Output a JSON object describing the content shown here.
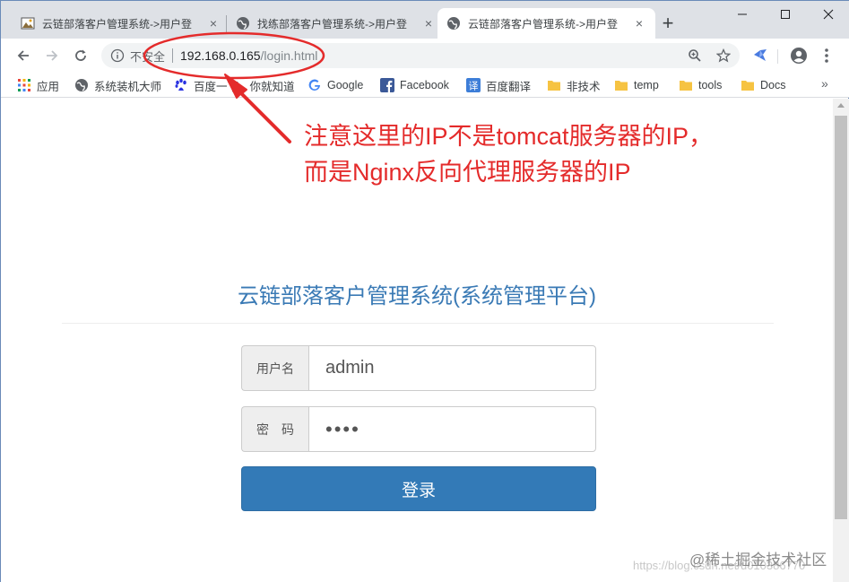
{
  "tabs": [
    {
      "title": "云链部落客户管理系统->用户登",
      "close": "×"
    },
    {
      "title": "找练部落客户管理系统->用户登",
      "close": "×"
    },
    {
      "title": "云链部落客户管理系统->用户登",
      "close": "×"
    }
  ],
  "new_tab": "+",
  "address": {
    "security_label": "不安全",
    "host": "192.168.0.165",
    "path": "/login.html"
  },
  "bookmarks": [
    {
      "label": "应用",
      "icon": "apps-grid-icon"
    },
    {
      "label": "系统装机大师",
      "icon": "globe-icon"
    },
    {
      "label": "百度一下，你就知道",
      "icon": "baidu-paw-icon"
    },
    {
      "label": "Google",
      "icon": "google-g-icon"
    },
    {
      "label": "Facebook",
      "icon": "facebook-icon"
    },
    {
      "label": "百度翻译",
      "icon": "translate-icon"
    },
    {
      "label": "非技术",
      "icon": "folder-icon"
    },
    {
      "label": "temp",
      "icon": "folder-icon"
    },
    {
      "label": "tools",
      "icon": "folder-icon"
    },
    {
      "label": "Docs",
      "icon": "folder-icon"
    }
  ],
  "bookmarks_more": "»",
  "annotation": {
    "line1": "注意这里的IP不是tomcat服务器的IP，",
    "line2": "而是Nginx反向代理服务器的IP"
  },
  "page": {
    "title": "云链部落客户管理系统(系统管理平台)",
    "username_label": "用户名",
    "username_value": "admin",
    "password_label": "密　码",
    "password_value": "••••",
    "login_button": "登录"
  },
  "watermark": {
    "primary": "@稀土掘金技术社区",
    "secondary": "https://blog.csdn.net/u010386770"
  },
  "colors": {
    "accent": "#337ab7",
    "title": "#3a7ab5",
    "annotation": "#e42b2b"
  }
}
